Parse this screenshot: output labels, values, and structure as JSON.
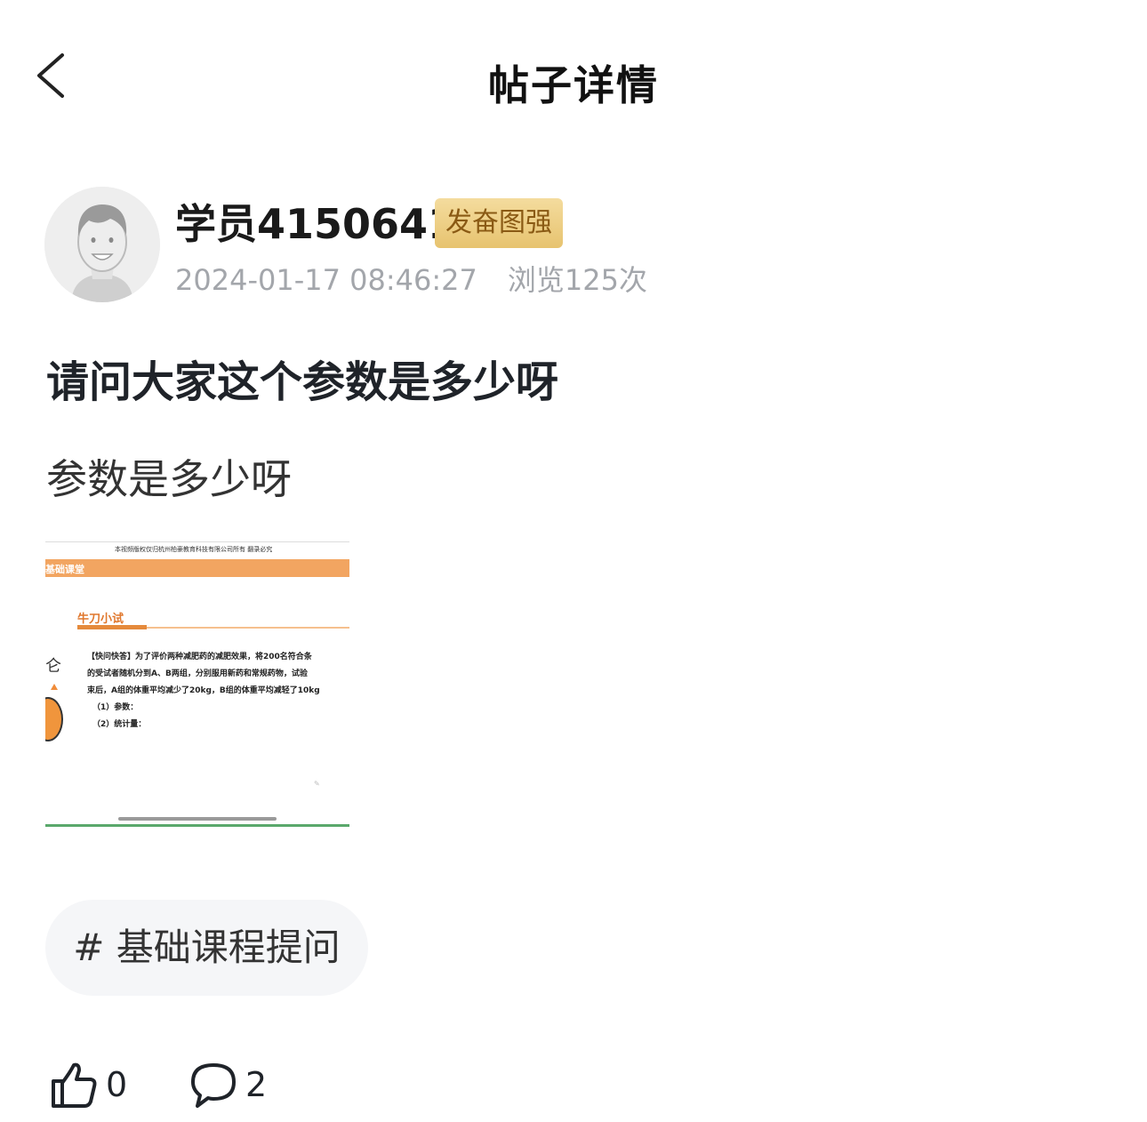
{
  "header": {
    "title": "帖子详情"
  },
  "author": {
    "name": "学员4150641",
    "badge": "发奋图强",
    "timestamp": "2024-01-17 08:46:27",
    "views": "浏览125次"
  },
  "post": {
    "title": "请问大家这个参数是多少呀",
    "body": "参数是多少呀"
  },
  "attachment": {
    "copyright": "本视频版权仅归杭州柏豪教育科技有限公司所有 翻录必究",
    "banner": "基础课堂",
    "section_title": "牛刀小试",
    "lines": [
      "【快问快答】为了评价两种减肥药的减肥效果，将200名符合条",
      "的受试者随机分到A、B两组，分别服用新药和常规药物，试验",
      "束后，A组的体重平均减少了20kg，B组的体重平均减轻了10kg",
      "（1）参数：",
      "（2）统计量："
    ]
  },
  "tag": {
    "label": "# 基础课程提问"
  },
  "actions": {
    "likes": "0",
    "comments": "2"
  }
}
